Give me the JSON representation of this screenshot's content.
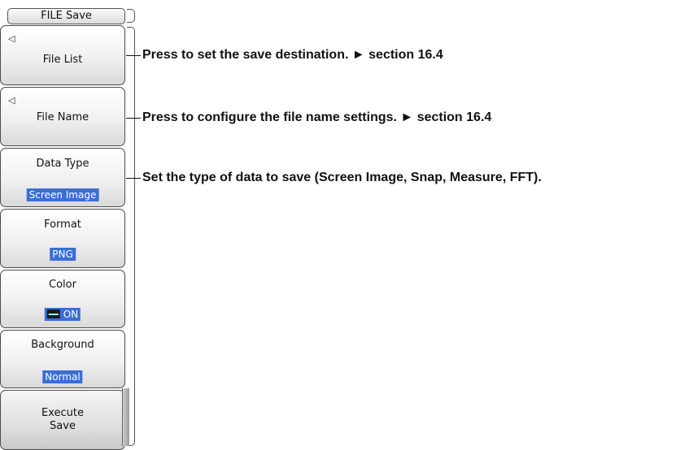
{
  "menu": {
    "title": "FILE Save",
    "keys": [
      {
        "mark": "◁",
        "label": "File List"
      },
      {
        "mark": "◁",
        "label": "File Name"
      },
      {
        "label": "Data Type",
        "value": "Screen Image"
      },
      {
        "label": "Format",
        "value": "PNG"
      },
      {
        "label": "Color",
        "value": "ON",
        "icon": "color-bar-icon"
      },
      {
        "label": "Background",
        "value": "Normal"
      },
      {
        "label_line1": "Execute",
        "label_line2": "Save"
      }
    ]
  },
  "annotations": [
    "Press to set the save destination. ► section 16.4",
    "Press to configure the file name settings. ► section 16.4",
    "Set the type of data to save (Screen Image, Snap, Measure, FFT)."
  ],
  "colors": {
    "highlight": "#3a6ed6"
  }
}
